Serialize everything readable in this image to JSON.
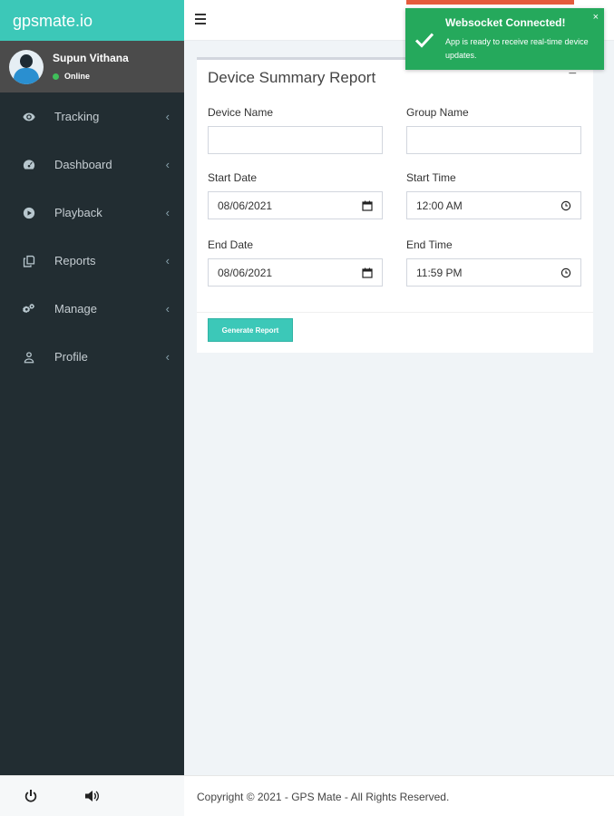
{
  "brand": {
    "name": "gpsmate.io"
  },
  "user": {
    "name": "Supun Vithana",
    "status": "Online"
  },
  "sidebar": {
    "items": [
      {
        "label": "Tracking",
        "icon": "eye-icon"
      },
      {
        "label": "Dashboard",
        "icon": "dashboard-icon"
      },
      {
        "label": "Playback",
        "icon": "play-icon"
      },
      {
        "label": "Reports",
        "icon": "reports-icon"
      },
      {
        "label": "Manage",
        "icon": "gears-icon"
      },
      {
        "label": "Profile",
        "icon": "user-icon"
      }
    ],
    "chevron": "‹"
  },
  "bottom_bar": {
    "icons": [
      "power-icon",
      "speaker-icon"
    ]
  },
  "report": {
    "title": "Device Summary Report",
    "collapse_symbol": "−",
    "device_name": {
      "label": "Device Name",
      "value": ""
    },
    "group_name": {
      "label": "Group Name",
      "value": ""
    },
    "start_date": {
      "label": "Start Date",
      "value": "08/06/2021"
    },
    "start_time": {
      "label": "Start Time",
      "value": "12:00 AM"
    },
    "end_date": {
      "label": "End Date",
      "value": "08/06/2021"
    },
    "end_time": {
      "label": "End Time",
      "value": "11:59 PM"
    },
    "generate_label": "Generate Report"
  },
  "footer": {
    "text": "Copyright © 2021 - GPS Mate - All Rights Reserved."
  },
  "toast": {
    "title": "Websocket Connected!",
    "message": "App is ready to receive real-time device updates.",
    "close": "×"
  },
  "colors": {
    "accent": "#3cc8b8",
    "sidebar_bg": "#222d32",
    "toast_bg": "#25a95c",
    "top_strip": "#e55b3c"
  }
}
